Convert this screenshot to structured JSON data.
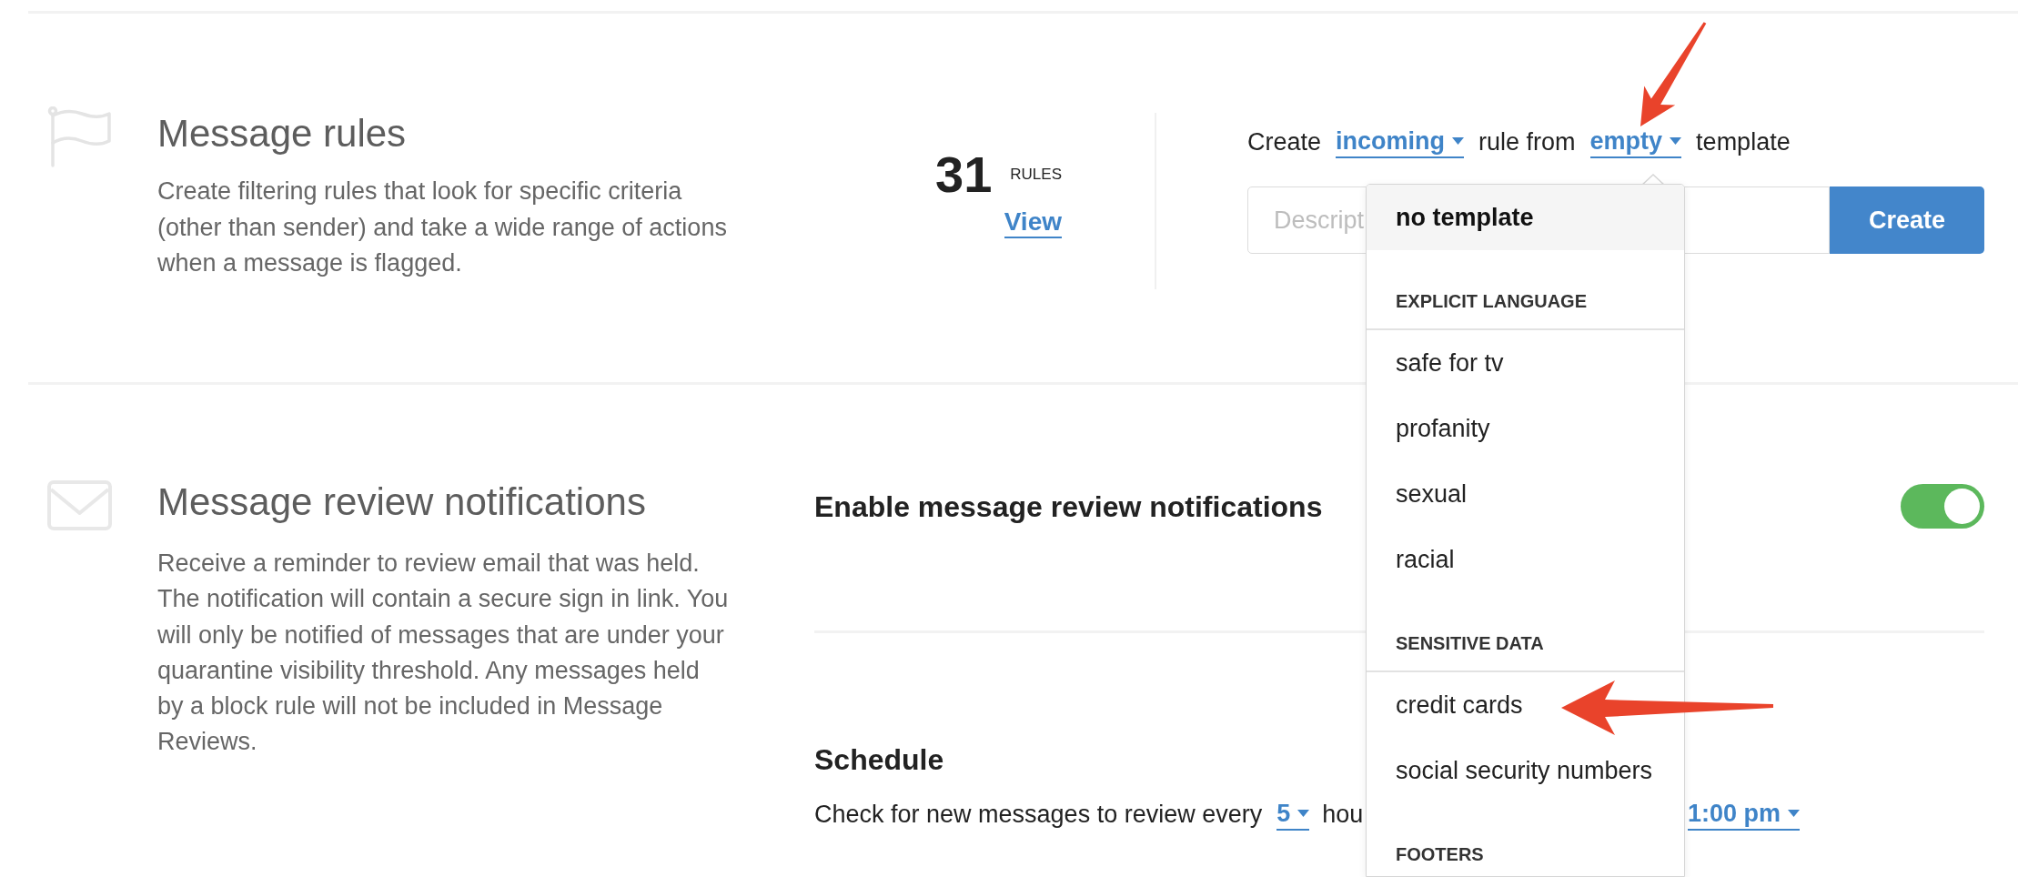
{
  "message_rules": {
    "title": "Message rules",
    "description": "Create filtering rules that look for specific criteria (other than sender) and take a wide range of actions when a message is flagged.",
    "count": "31",
    "count_unit": "RULES",
    "view_link": "View"
  },
  "rule_builder": {
    "prefix": "Create",
    "direction": "incoming",
    "middle": "rule from",
    "template": "empty",
    "suffix": "template",
    "description_field": {
      "placeholder": "Descript"
    },
    "create_button": "Create"
  },
  "template_menu": {
    "options": [
      {
        "label": "no template",
        "selected": true
      }
    ],
    "groups": [
      {
        "heading": "EXPLICIT LANGUAGE",
        "options": [
          {
            "label": "safe for tv",
            "selected": false
          },
          {
            "label": "profanity",
            "selected": false
          },
          {
            "label": "sexual",
            "selected": false
          },
          {
            "label": "racial",
            "selected": false
          }
        ]
      },
      {
        "heading": "SENSITIVE DATA",
        "options": [
          {
            "label": "credit cards",
            "selected": false
          },
          {
            "label": "social security numbers",
            "selected": false
          }
        ]
      },
      {
        "heading": "FOOTERS"
      }
    ]
  },
  "review_notifications": {
    "title": "Message review notifications",
    "description": "Receive a reminder to review email that was held. The notification will contain a secure sign in link. You will only be notified of messages that are under your quarantine visibility threshold. Any messages held by a block rule will not be included in Message Reviews.",
    "enable_label": "Enable message review notifications",
    "enabled": true,
    "schedule": {
      "heading": "Schedule",
      "text": "Check for new messages to review every",
      "interval": "5",
      "after_interval": "hou",
      "time": "1:00 pm"
    }
  }
}
